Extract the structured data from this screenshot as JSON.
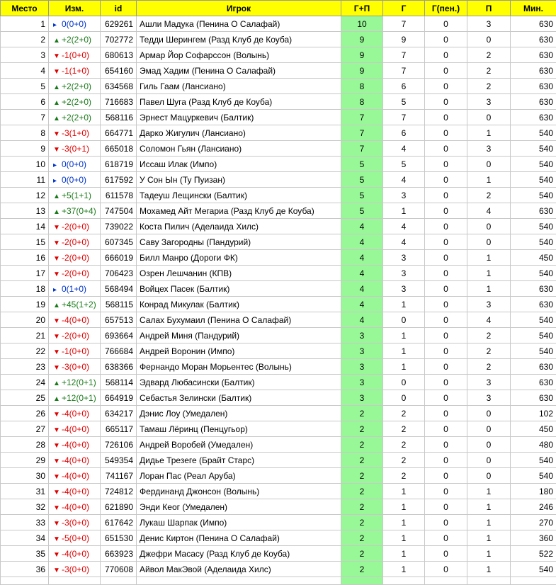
{
  "headers": [
    "Место",
    "Изм.",
    "id",
    "Игрок",
    "Г+П",
    "Г",
    "Г(пен.)",
    "П",
    "Мин."
  ],
  "colors": {
    "header_bg": "#ffff00",
    "gp_bg": "#98f898",
    "up": "#1a7a1a",
    "down": "#e00000",
    "same": "#0033cc"
  },
  "rows": [
    {
      "rank": "1",
      "dir": "same",
      "change": "0(0+0)",
      "id": "629261",
      "player": "Ашли Мадука (Пенина О Салафай)",
      "gp": "10",
      "g": "7",
      "pen": "0",
      "p": "3",
      "min": "630"
    },
    {
      "rank": "2",
      "dir": "up",
      "change": "+2(2+0)",
      "id": "702772",
      "player": "Тедди Шерингем (Разд Клуб де Коуба)",
      "gp": "9",
      "g": "9",
      "pen": "0",
      "p": "0",
      "min": "630"
    },
    {
      "rank": "3",
      "dir": "down",
      "change": "-1(0+0)",
      "id": "680613",
      "player": "Армар Йор Софарссон (Волынь)",
      "gp": "9",
      "g": "7",
      "pen": "0",
      "p": "2",
      "min": "630"
    },
    {
      "rank": "4",
      "dir": "down",
      "change": "-1(1+0)",
      "id": "654160",
      "player": "Эмад Хадим (Пенина О Салафай)",
      "gp": "9",
      "g": "7",
      "pen": "0",
      "p": "2",
      "min": "630"
    },
    {
      "rank": "5",
      "dir": "up",
      "change": "+2(2+0)",
      "id": "634568",
      "player": "Гиль Гаам (Лансиано)",
      "gp": "8",
      "g": "6",
      "pen": "0",
      "p": "2",
      "min": "630"
    },
    {
      "rank": "6",
      "dir": "up",
      "change": "+2(2+0)",
      "id": "716683",
      "player": "Павел Шуга (Разд Клуб де Коуба)",
      "gp": "8",
      "g": "5",
      "pen": "0",
      "p": "3",
      "min": "630"
    },
    {
      "rank": "7",
      "dir": "up",
      "change": "+2(2+0)",
      "id": "568116",
      "player": "Эрнест Мацуркевич (Балтик)",
      "gp": "7",
      "g": "7",
      "pen": "0",
      "p": "0",
      "min": "630"
    },
    {
      "rank": "8",
      "dir": "down",
      "change": "-3(1+0)",
      "id": "664771",
      "player": "Дарко Жигулич (Лансиано)",
      "gp": "7",
      "g": "6",
      "pen": "0",
      "p": "1",
      "min": "540"
    },
    {
      "rank": "9",
      "dir": "down",
      "change": "-3(0+1)",
      "id": "665018",
      "player": "Соломон Гьян (Лансиано)",
      "gp": "7",
      "g": "4",
      "pen": "0",
      "p": "3",
      "min": "540"
    },
    {
      "rank": "10",
      "dir": "same",
      "change": "0(0+0)",
      "id": "618719",
      "player": "Иссаш Илак (Импо)",
      "gp": "5",
      "g": "5",
      "pen": "0",
      "p": "0",
      "min": "540"
    },
    {
      "rank": "11",
      "dir": "same",
      "change": "0(0+0)",
      "id": "617592",
      "player": "У Сон Ын (Ту Пуизан)",
      "gp": "5",
      "g": "4",
      "pen": "0",
      "p": "1",
      "min": "540"
    },
    {
      "rank": "12",
      "dir": "up",
      "change": "+5(1+1)",
      "id": "611578",
      "player": "Тадеуш Лещински (Балтик)",
      "gp": "5",
      "g": "3",
      "pen": "0",
      "p": "2",
      "min": "540"
    },
    {
      "rank": "13",
      "dir": "up",
      "change": "+37(0+4)",
      "id": "747504",
      "player": "Мохамед Айт Мегариа (Разд Клуб де Коуба)",
      "gp": "5",
      "g": "1",
      "pen": "0",
      "p": "4",
      "min": "630"
    },
    {
      "rank": "14",
      "dir": "down",
      "change": "-2(0+0)",
      "id": "739022",
      "player": "Коста Пилич (Аделаида Хилс)",
      "gp": "4",
      "g": "4",
      "pen": "0",
      "p": "0",
      "min": "540"
    },
    {
      "rank": "15",
      "dir": "down",
      "change": "-2(0+0)",
      "id": "607345",
      "player": "Саву Загородны (Пандурий)",
      "gp": "4",
      "g": "4",
      "pen": "0",
      "p": "0",
      "min": "540"
    },
    {
      "rank": "16",
      "dir": "down",
      "change": "-2(0+0)",
      "id": "666019",
      "player": "Билл Манро (Дороги ФК)",
      "gp": "4",
      "g": "3",
      "pen": "0",
      "p": "1",
      "min": "450"
    },
    {
      "rank": "17",
      "dir": "down",
      "change": "-2(0+0)",
      "id": "706423",
      "player": "Озрен Лешчанин (КПВ)",
      "gp": "4",
      "g": "3",
      "pen": "0",
      "p": "1",
      "min": "540"
    },
    {
      "rank": "18",
      "dir": "same",
      "change": "0(1+0)",
      "id": "568494",
      "player": "Войцех Пасек (Балтик)",
      "gp": "4",
      "g": "3",
      "pen": "0",
      "p": "1",
      "min": "630"
    },
    {
      "rank": "19",
      "dir": "up",
      "change": "+45(1+2)",
      "id": "568115",
      "player": "Конрад Микулак (Балтик)",
      "gp": "4",
      "g": "1",
      "pen": "0",
      "p": "3",
      "min": "630"
    },
    {
      "rank": "20",
      "dir": "down",
      "change": "-4(0+0)",
      "id": "657513",
      "player": "Салах Бухумаил (Пенина О Салафай)",
      "gp": "4",
      "g": "0",
      "pen": "0",
      "p": "4",
      "min": "540"
    },
    {
      "rank": "21",
      "dir": "down",
      "change": "-2(0+0)",
      "id": "693664",
      "player": "Андрей Миня (Пандурий)",
      "gp": "3",
      "g": "1",
      "pen": "0",
      "p": "2",
      "min": "540"
    },
    {
      "rank": "22",
      "dir": "down",
      "change": "-1(0+0)",
      "id": "766684",
      "player": "Андрей Воронин (Импо)",
      "gp": "3",
      "g": "1",
      "pen": "0",
      "p": "2",
      "min": "540"
    },
    {
      "rank": "23",
      "dir": "down",
      "change": "-3(0+0)",
      "id": "638366",
      "player": "Фернандо Моран Морьентес (Волынь)",
      "gp": "3",
      "g": "1",
      "pen": "0",
      "p": "2",
      "min": "630"
    },
    {
      "rank": "24",
      "dir": "up",
      "change": "+12(0+1)",
      "id": "568114",
      "player": "Эдвард Любасински (Балтик)",
      "gp": "3",
      "g": "0",
      "pen": "0",
      "p": "3",
      "min": "630"
    },
    {
      "rank": "25",
      "dir": "up",
      "change": "+12(0+1)",
      "id": "664919",
      "player": "Себастья Зелински (Балтик)",
      "gp": "3",
      "g": "0",
      "pen": "0",
      "p": "3",
      "min": "630"
    },
    {
      "rank": "26",
      "dir": "down",
      "change": "-4(0+0)",
      "id": "634217",
      "player": "Дэнис Лоу (Умедален)",
      "gp": "2",
      "g": "2",
      "pen": "0",
      "p": "0",
      "min": "102"
    },
    {
      "rank": "27",
      "dir": "down",
      "change": "-4(0+0)",
      "id": "665117",
      "player": "Тамаш Лёринц (Пенцугьор)",
      "gp": "2",
      "g": "2",
      "pen": "0",
      "p": "0",
      "min": "450"
    },
    {
      "rank": "28",
      "dir": "down",
      "change": "-4(0+0)",
      "id": "726106",
      "player": "Андрей Воробей (Умедален)",
      "gp": "2",
      "g": "2",
      "pen": "0",
      "p": "0",
      "min": "480"
    },
    {
      "rank": "29",
      "dir": "down",
      "change": "-4(0+0)",
      "id": "549354",
      "player": "Дидье Трезеге (Брайт Старс)",
      "gp": "2",
      "g": "2",
      "pen": "0",
      "p": "0",
      "min": "540"
    },
    {
      "rank": "30",
      "dir": "down",
      "change": "-4(0+0)",
      "id": "741167",
      "player": "Лоран Пас (Реал Аруба)",
      "gp": "2",
      "g": "2",
      "pen": "0",
      "p": "0",
      "min": "540"
    },
    {
      "rank": "31",
      "dir": "down",
      "change": "-4(0+0)",
      "id": "724812",
      "player": "Фердинанд Джонсон (Волынь)",
      "gp": "2",
      "g": "1",
      "pen": "0",
      "p": "1",
      "min": "180"
    },
    {
      "rank": "32",
      "dir": "down",
      "change": "-4(0+0)",
      "id": "621890",
      "player": "Энди Кеог (Умедален)",
      "gp": "2",
      "g": "1",
      "pen": "0",
      "p": "1",
      "min": "246"
    },
    {
      "rank": "33",
      "dir": "down",
      "change": "-3(0+0)",
      "id": "617642",
      "player": "Лукаш Шарпак (Импо)",
      "gp": "2",
      "g": "1",
      "pen": "0",
      "p": "1",
      "min": "270"
    },
    {
      "rank": "34",
      "dir": "down",
      "change": "-5(0+0)",
      "id": "651530",
      "player": "Денис Киртон (Пенина О Салафай)",
      "gp": "2",
      "g": "1",
      "pen": "0",
      "p": "1",
      "min": "360"
    },
    {
      "rank": "35",
      "dir": "down",
      "change": "-4(0+0)",
      "id": "663923",
      "player": "Джефри Масасу (Разд Клуб де Коуба)",
      "gp": "2",
      "g": "1",
      "pen": "0",
      "p": "1",
      "min": "522"
    },
    {
      "rank": "36",
      "dir": "down",
      "change": "-3(0+0)",
      "id": "770608",
      "player": "Айвол МакЭвой (Аделаида Хилс)",
      "gp": "2",
      "g": "1",
      "pen": "0",
      "p": "1",
      "min": "540"
    }
  ]
}
